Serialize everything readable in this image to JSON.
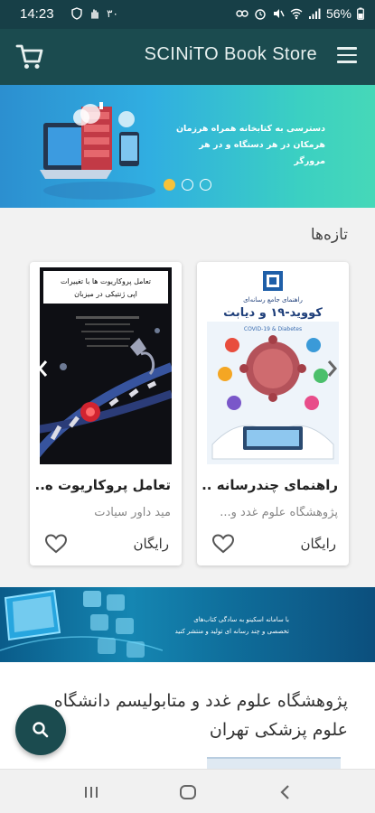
{
  "status_bar": {
    "time": "14:23",
    "left_icon_text": "۳۰",
    "battery": "56%"
  },
  "app_bar": {
    "title": "SCINiTO Book Store",
    "cart_icon": "cart-icon",
    "menu_icon": "hamburger-menu-icon"
  },
  "hero_banner": {
    "text_line1": "دسترسی به کتابخانه همراه هرزمان",
    "text_line2": "هرمکان در هر دستگاه و در هر مرورگر",
    "slides": 3,
    "active_slide": 1,
    "colors": {
      "start": "#2c8fd0",
      "end": "#46d8b8",
      "active_dot": "#f7c23a"
    }
  },
  "new_section": {
    "title": "تازه‌ها",
    "books": [
      {
        "title": "راهنمای چندرسانه ...",
        "author": "پژوهشگاه علوم غدد و...",
        "price": "رایگان",
        "cover_title": "راهنمای جامع رسانه‌ای",
        "cover_subtitle": "کووید-۱۹ و دیابت",
        "cover_english": "COVID-19 & Diabetes"
      },
      {
        "title": "تعامل پروکاریوت ه...",
        "author": "مید داور سیادت",
        "price": "رایگان",
        "cover_title": "تعامل پروکاریوت ها با تغییرات",
        "cover_subtitle": "اپی ژنتیکی در میزبان"
      }
    ]
  },
  "banner2": {
    "text_line1": "با سامانه اسکینو به سادگی کتاب‌های",
    "text_line2": "تخصصی و چند رسانه ای تولید و منتشر کنید"
  },
  "publisher_section": {
    "title": "پژوهشگاه علوم غدد و متابولیسم دانشگاه علوم پزشکی تهران"
  },
  "fab": {
    "icon": "search-icon"
  },
  "nav_bar": {
    "recent": "recent-apps-icon",
    "home": "home-icon",
    "back": "back-icon"
  },
  "theme": {
    "primary": "#1b4b4f",
    "status": "#173f47"
  }
}
